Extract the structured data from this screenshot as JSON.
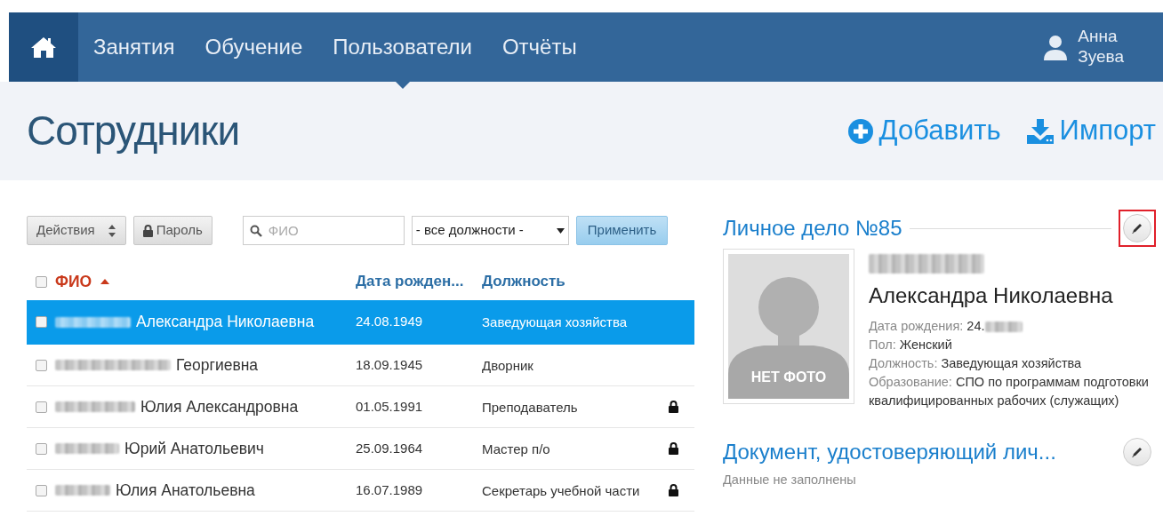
{
  "nav": {
    "items": [
      {
        "label": "Занятия",
        "selected": false
      },
      {
        "label": "Обучение",
        "selected": false
      },
      {
        "label": "Пользователи",
        "selected": true
      },
      {
        "label": "Отчёты",
        "selected": false
      }
    ],
    "user": {
      "first_name": "Анна",
      "last_name": "Зуева"
    }
  },
  "page": {
    "title": "Сотрудники",
    "actions": [
      {
        "kind": "add",
        "label": "Добавить"
      },
      {
        "kind": "import",
        "label": "Импорт"
      }
    ]
  },
  "toolbar": {
    "actions_button": "Действия",
    "password_button": "Пароль",
    "search": {
      "placeholder": "ФИО"
    },
    "position_select": "- все должности -",
    "apply_button": "Применить"
  },
  "table": {
    "select_all_checked": false,
    "columns": [
      {
        "label": "ФИО",
        "sorted": true
      },
      {
        "label": "Дата рожден...",
        "sorted": false
      },
      {
        "label": "Должность",
        "sorted": false
      }
    ],
    "rows": [
      {
        "surname_blurred": true,
        "name": "Александра Николаевна",
        "birth_date": "24.08.1949",
        "position": "Заведующая хозяйства",
        "locked": false,
        "checked": false,
        "selected": true
      },
      {
        "surname_blurred": true,
        "name": "Георгиевна",
        "birth_date": "18.09.1945",
        "position": "Дворник",
        "locked": false,
        "checked": false,
        "selected": false
      },
      {
        "surname_blurred": true,
        "name": "Юлия Александровна",
        "birth_date": "01.05.1991",
        "position": "Преподаватель",
        "locked": true,
        "checked": false,
        "selected": false
      },
      {
        "surname_blurred": true,
        "name": "Юрий Анатольевич",
        "birth_date": "25.09.1964",
        "position": "Мастер п/о",
        "locked": true,
        "checked": false,
        "selected": false
      },
      {
        "surname_blurred": true,
        "name": "Юлия Анатольевна",
        "birth_date": "16.07.1989",
        "position": "Секретарь учебной части",
        "locked": true,
        "checked": false,
        "selected": false
      }
    ]
  },
  "profile": {
    "title": "Личное дело №85",
    "edit_highlighted": true,
    "photo_caption": "НЕТ ФОТО",
    "surname_blurred": true,
    "name": "Александра Николаевна",
    "fields": [
      {
        "label": "Дата рождения:",
        "value": "24.",
        "value_blurred": true
      },
      {
        "label": "Пол:",
        "value": "Женский",
        "value_blurred": false
      },
      {
        "label": "Должность:",
        "value": "Заведующая хозяйства",
        "value_blurred": false
      },
      {
        "label": "Образование:",
        "value": "СПО по программам подготовки квалифицированных рабочих (служащих)",
        "value_blurred": false
      }
    ]
  },
  "document": {
    "title": "Документ, удостоверяющий лич...",
    "note": "Данные не заполнены"
  }
}
